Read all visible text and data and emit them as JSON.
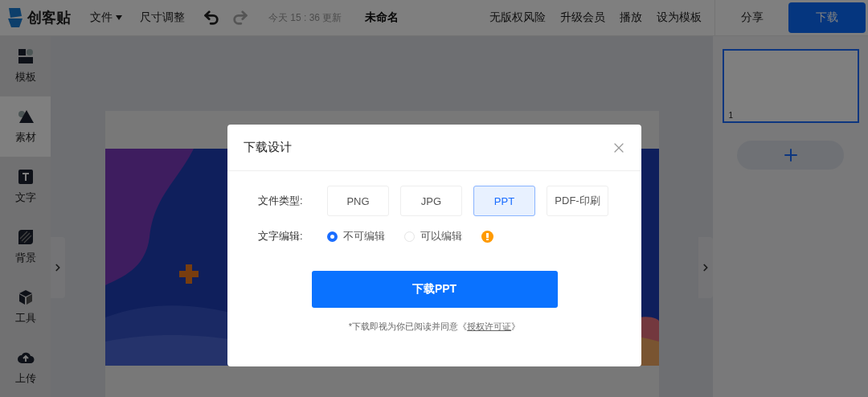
{
  "topbar": {
    "logo_text": "创客贴",
    "menu": [
      {
        "label": "文件",
        "kind": "dropdown"
      },
      {
        "label": "尺寸调整",
        "kind": "plain"
      }
    ],
    "history": [
      {
        "kind": "undo",
        "disabled": false
      },
      {
        "kind": "redo",
        "disabled": true
      }
    ],
    "save_status": "今天 15 : 36 更新",
    "doc_title": "未命名",
    "links": [
      "无版权风险",
      "升级会员",
      "播放",
      "设为模板"
    ],
    "share": "分享",
    "download": "下载"
  },
  "sidebar": {
    "items": [
      {
        "label": "模板",
        "kind": "template",
        "selected": false
      },
      {
        "label": "素材",
        "kind": "element",
        "selected": true
      },
      {
        "label": "文字",
        "kind": "text",
        "selected": false
      },
      {
        "label": "背景",
        "kind": "background",
        "selected": false
      },
      {
        "label": "工具",
        "kind": "tool",
        "selected": false
      },
      {
        "label": "上传",
        "kind": "upload",
        "selected": false
      }
    ]
  },
  "pages": {
    "items": [
      {
        "number": "1",
        "selected": true
      }
    ]
  },
  "dialog": {
    "title": "下载设计",
    "file_type": {
      "label": "文件类型:",
      "options": [
        {
          "label": "PNG",
          "selected": false
        },
        {
          "label": "JPG",
          "selected": false
        },
        {
          "label": "PPT",
          "selected": true
        },
        {
          "label": "PDF-印刷",
          "selected": false
        }
      ]
    },
    "text_edit": {
      "label": "文字编辑:",
      "options": [
        {
          "label": "不可编辑",
          "selected": true
        },
        {
          "label": "可以编辑",
          "selected": false
        }
      ]
    },
    "download_button": "下载PPT",
    "notice": {
      "before": "*下载即视为你已阅读并同意《",
      "link": "授权许可证",
      "after": "》"
    }
  }
}
